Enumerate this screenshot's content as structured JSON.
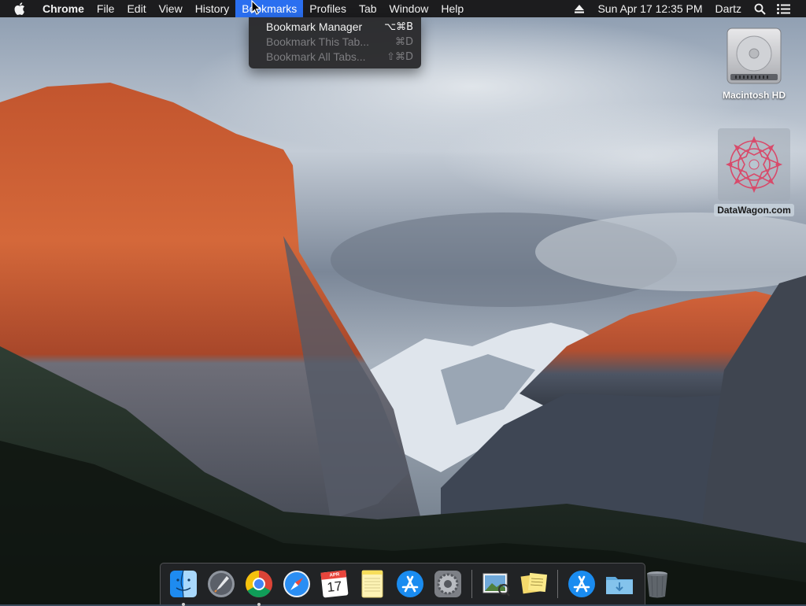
{
  "menubar": {
    "app_name": "Chrome",
    "menus": [
      "File",
      "Edit",
      "View",
      "History",
      "Bookmarks",
      "Profiles",
      "Tab",
      "Window",
      "Help"
    ],
    "active_menu": "Bookmarks",
    "clock": "Sun Apr 17  12:35 PM",
    "user": "Dartz",
    "icons": [
      "apple-logo",
      "eject-icon",
      "spotlight-search-icon",
      "notification-center-icon"
    ]
  },
  "bookmarks_menu": {
    "items": [
      {
        "label": "Bookmark Manager",
        "shortcut": "⌥⌘B",
        "enabled": true
      },
      {
        "label": "Bookmark This Tab...",
        "shortcut": "⌘D",
        "enabled": false
      },
      {
        "label": "Bookmark All Tabs...",
        "shortcut": "⇧⌘D",
        "enabled": false
      }
    ]
  },
  "desktop": {
    "drive_label": "Macintosh HD",
    "file_label": "DataWagon.com"
  },
  "dock": {
    "apps": [
      "finder",
      "launchpad",
      "chrome",
      "safari",
      "calendar",
      "notes",
      "app-store",
      "system-preferences",
      "preview",
      "stickies",
      "app-store-folder",
      "downloads-folder",
      "trash"
    ],
    "calendar_month": "APR",
    "calendar_day": "17"
  },
  "colors": {
    "menubar_bg": "#1c1c1e",
    "menu_highlight": "#2a6ff0",
    "dock_bg": "rgba(40,40,46,0.72)"
  }
}
